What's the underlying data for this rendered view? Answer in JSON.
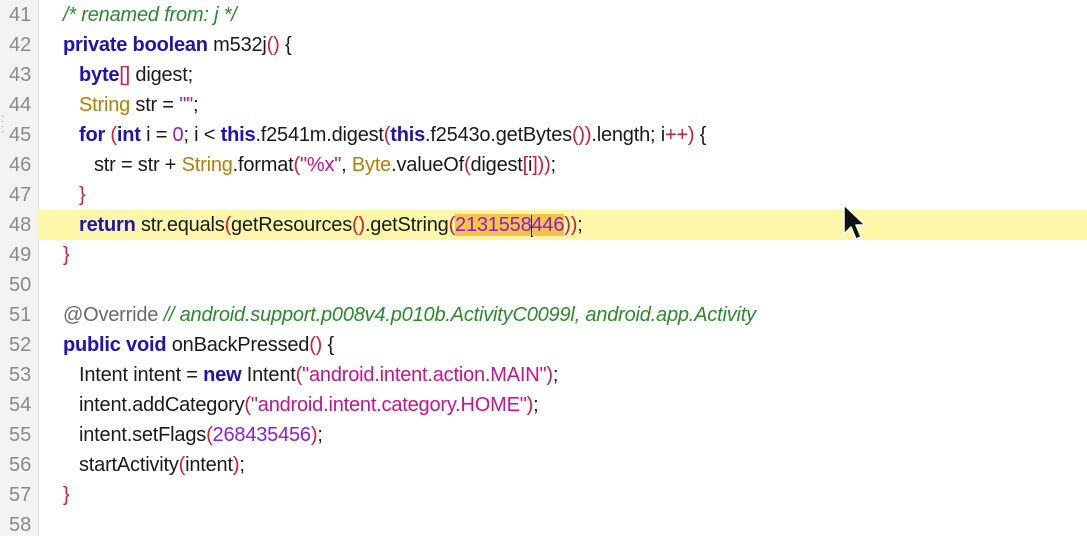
{
  "editor": {
    "lines": [
      {
        "number": "41",
        "tokens": [
          {
            "t": "/* renamed from: j */",
            "c": "comment"
          }
        ]
      },
      {
        "number": "42",
        "tokens": [
          {
            "t": "private",
            "c": "kw"
          },
          {
            "t": " ",
            "c": ""
          },
          {
            "t": "boolean",
            "c": "kw"
          },
          {
            "t": " m532j",
            "c": ""
          },
          {
            "t": "()",
            "c": "paren"
          },
          {
            "t": " {",
            "c": ""
          }
        ]
      },
      {
        "number": "43",
        "indent": 1,
        "tokens": [
          {
            "t": "byte",
            "c": "kw"
          },
          {
            "t": "[]",
            "c": "paren"
          },
          {
            "t": " digest;",
            "c": ""
          }
        ]
      },
      {
        "number": "44",
        "indent": 1,
        "tokens": [
          {
            "t": "String",
            "c": "type"
          },
          {
            "t": " str = ",
            "c": ""
          },
          {
            "t": "\"\"",
            "c": "str"
          },
          {
            "t": ";",
            "c": ""
          }
        ]
      },
      {
        "number": "45",
        "indent": 1,
        "tokens": [
          {
            "t": "for",
            "c": "kw"
          },
          {
            "t": " ",
            "c": ""
          },
          {
            "t": "(",
            "c": "paren"
          },
          {
            "t": "int",
            "c": "kw"
          },
          {
            "t": " i = ",
            "c": ""
          },
          {
            "t": "0",
            "c": "num"
          },
          {
            "t": "; i < ",
            "c": ""
          },
          {
            "t": "this",
            "c": "kw"
          },
          {
            "t": ".f2541m.digest",
            "c": ""
          },
          {
            "t": "(",
            "c": "paren"
          },
          {
            "t": "this",
            "c": "kw"
          },
          {
            "t": ".f2543o.getBytes",
            "c": ""
          },
          {
            "t": "())",
            "c": "paren"
          },
          {
            "t": ".length; i",
            "c": ""
          },
          {
            "t": "++",
            "c": "paren"
          },
          {
            "t": ") ",
            "c": "paren"
          },
          {
            "t": "{",
            "c": ""
          }
        ]
      },
      {
        "number": "46",
        "indent": 2,
        "tokens": [
          {
            "t": "str = str + ",
            "c": ""
          },
          {
            "t": "String",
            "c": "type"
          },
          {
            "t": ".format",
            "c": ""
          },
          {
            "t": "(",
            "c": "paren"
          },
          {
            "t": "\"%x\"",
            "c": "str"
          },
          {
            "t": ", ",
            "c": ""
          },
          {
            "t": "Byte",
            "c": "type"
          },
          {
            "t": ".valueOf",
            "c": ""
          },
          {
            "t": "(",
            "c": "paren"
          },
          {
            "t": "digest",
            "c": ""
          },
          {
            "t": "[",
            "c": "paren"
          },
          {
            "t": "i",
            "c": ""
          },
          {
            "t": "]))",
            "c": "paren"
          },
          {
            "t": ";",
            "c": ""
          }
        ]
      },
      {
        "number": "47",
        "indent": 1,
        "tokens": [
          {
            "t": "}",
            "c": "paren"
          }
        ]
      },
      {
        "number": "48",
        "indent": 1,
        "highlight": true,
        "tokens": [
          {
            "t": "return",
            "c": "kw"
          },
          {
            "t": " str.equals",
            "c": ""
          },
          {
            "t": "(",
            "c": "paren"
          },
          {
            "t": "getResources",
            "c": ""
          },
          {
            "t": "()",
            "c": "paren"
          },
          {
            "t": ".getString",
            "c": ""
          },
          {
            "t": "(",
            "c": "paren"
          },
          {
            "t": "2131558",
            "c": "sel-num"
          },
          {
            "t": "",
            "c": "caret"
          },
          {
            "t": "446",
            "c": "sel-num"
          },
          {
            "t": "))",
            "c": "paren"
          },
          {
            "t": ";",
            "c": ""
          }
        ]
      },
      {
        "number": "49",
        "tokens": [
          {
            "t": "}",
            "c": "paren"
          }
        ]
      },
      {
        "number": "50",
        "tokens": []
      },
      {
        "number": "51",
        "tokens": [
          {
            "t": "@Override",
            "c": "anno"
          },
          {
            "t": " ",
            "c": ""
          },
          {
            "t": "// android.support.p008v4.p010b.ActivityC0099l, android.app.Activity",
            "c": "comment-dark"
          }
        ]
      },
      {
        "number": "52",
        "tokens": [
          {
            "t": "public",
            "c": "kw"
          },
          {
            "t": " ",
            "c": ""
          },
          {
            "t": "void",
            "c": "kw"
          },
          {
            "t": " onBackPressed",
            "c": ""
          },
          {
            "t": "()",
            "c": "paren"
          },
          {
            "t": " {",
            "c": ""
          }
        ]
      },
      {
        "number": "53",
        "indent": 1,
        "tokens": [
          {
            "t": "Intent intent = ",
            "c": ""
          },
          {
            "t": "new",
            "c": "kw"
          },
          {
            "t": " Intent",
            "c": ""
          },
          {
            "t": "(",
            "c": "paren"
          },
          {
            "t": "\"android.intent.action.MAIN\"",
            "c": "str"
          },
          {
            "t": ")",
            "c": "paren"
          },
          {
            "t": ";",
            "c": ""
          }
        ]
      },
      {
        "number": "54",
        "indent": 1,
        "tokens": [
          {
            "t": "intent.addCategory",
            "c": ""
          },
          {
            "t": "(",
            "c": "paren"
          },
          {
            "t": "\"android.intent.category.HOME\"",
            "c": "str"
          },
          {
            "t": ")",
            "c": "paren"
          },
          {
            "t": ";",
            "c": ""
          }
        ]
      },
      {
        "number": "55",
        "indent": 1,
        "tokens": [
          {
            "t": "intent.setFlags",
            "c": ""
          },
          {
            "t": "(",
            "c": "paren"
          },
          {
            "t": "268435456",
            "c": "num"
          },
          {
            "t": ")",
            "c": "paren"
          },
          {
            "t": ";",
            "c": ""
          }
        ]
      },
      {
        "number": "56",
        "indent": 1,
        "tokens": [
          {
            "t": "startActivity",
            "c": ""
          },
          {
            "t": "(",
            "c": "paren"
          },
          {
            "t": "intent",
            "c": ""
          },
          {
            "t": ")",
            "c": "paren"
          },
          {
            "t": ";",
            "c": ""
          }
        ]
      },
      {
        "number": "57",
        "tokens": [
          {
            "t": "}",
            "c": "paren"
          }
        ]
      },
      {
        "number": "58",
        "tokens": []
      }
    ]
  },
  "icons": {
    "gutter_grip": "grip-dots-icon",
    "cursor": "mouse-pointer-icon"
  },
  "colors": {
    "keyword": "#1d13b8",
    "type": "#b37f00",
    "string": "#c7128e",
    "number": "#8a1fd6",
    "comment": "#2b8a2b",
    "paren": "#d8183d",
    "current_line": "#fcf7a8",
    "selection": "#f8c246"
  }
}
